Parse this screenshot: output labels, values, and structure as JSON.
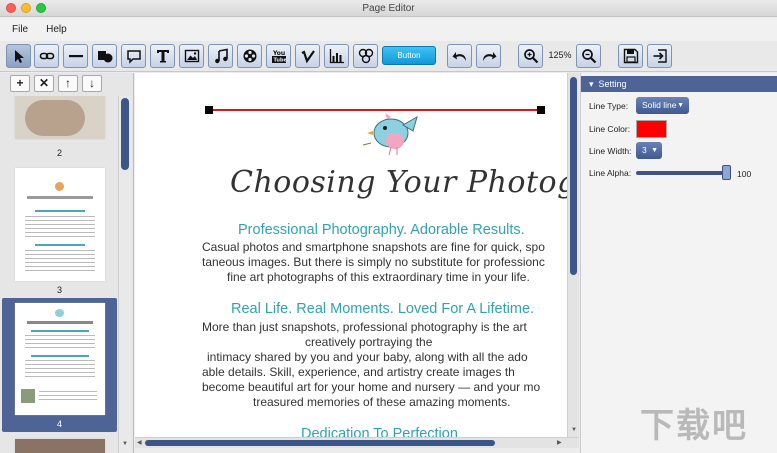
{
  "window": {
    "title": "Page Editor"
  },
  "menu": {
    "items": [
      "File",
      "Help"
    ]
  },
  "toolbar": {
    "button_label": "Button",
    "zoom": "125%"
  },
  "left_panel": {
    "pages": [
      "2",
      "3",
      "4"
    ]
  },
  "canvas": {
    "title": "Choosing Your Photographer",
    "subheads": [
      "Professional Photography. Adorable Results.",
      "Real Life. Real Moments. Loved For A Lifetime.",
      "Dedication To Perfection"
    ],
    "para1": [
      "Casual photos and smartphone snapshots are fine for quick, spo",
      "taneous images. But there is simply no substitute for professionc",
      "fine art photographs of this extraordinary time in your life."
    ],
    "para2": [
      "More than just snapshots, professional photography is the art",
      "creatively portraying the",
      "intimacy shared by you and your baby, along with all the ado",
      "able details. Skill, experience, and artistry create images th",
      "become beautiful art for your home and nursery — and your mo",
      "treasured memories of these amazing moments."
    ]
  },
  "settings": {
    "header": "Setting",
    "line_type_label": "Line Type:",
    "line_type_value": "Solid line",
    "line_color_label": "Line Color:",
    "line_color": "#ff0000",
    "line_width_label": "Line Width:",
    "line_width_value": "3",
    "line_alpha_label": "Line Alpha:",
    "line_alpha_value": "100"
  },
  "watermark": "下载吧",
  "colors": {
    "accent": "#3c5688",
    "teal_text": "#31a3b0",
    "button_blue": "#1297d6",
    "header_bg": "#4e6496"
  }
}
